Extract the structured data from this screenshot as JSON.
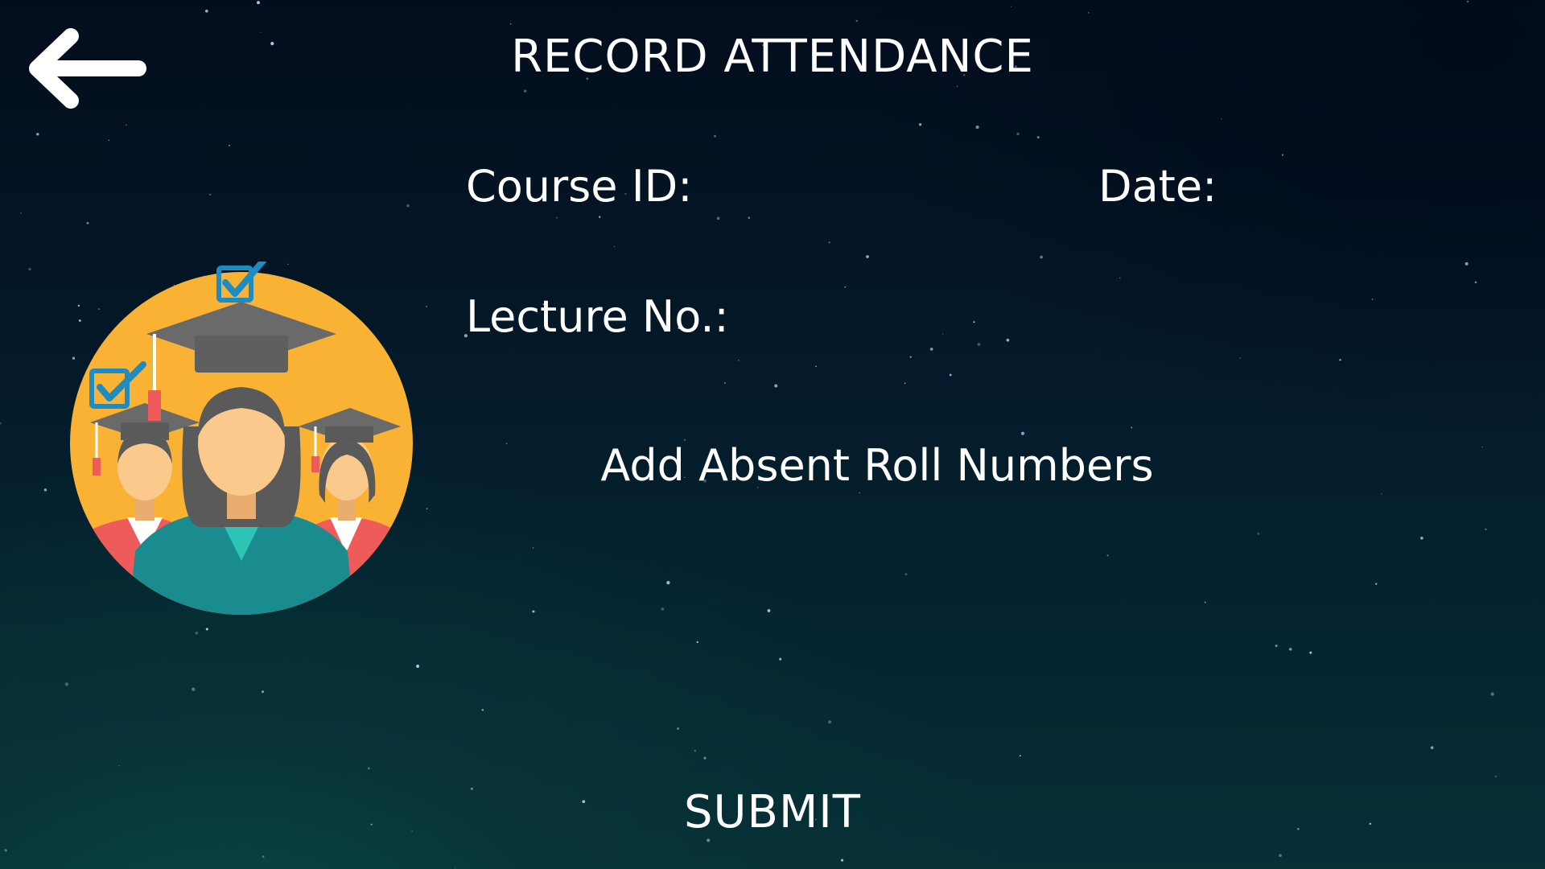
{
  "header": {
    "title": "RECORD ATTENDANCE",
    "back_icon": "arrow-left-icon"
  },
  "form": {
    "course_id_label": "Course ID:",
    "course_id_value": "",
    "date_label": "Date:",
    "date_value": "",
    "lecture_label": "Lecture No.:",
    "lecture_value": ""
  },
  "actions": {
    "add_absent_label": "Add Absent Roll Numbers",
    "submit_label": "SUBMIT"
  },
  "illustration": {
    "icon": "graduates-attendance-icon",
    "colors": {
      "circle": "#f9b233",
      "cap": "#6a6a6a",
      "skin": "#fbc98c",
      "hair": "#5a5a5a",
      "teal_gown": "#1a8c90",
      "red_gown": "#ef5b5b",
      "check": "#1e8bc3"
    }
  },
  "theme": {
    "background_top": "#030d1d",
    "background_bottom": "#062f36",
    "text": "#ffffff"
  }
}
